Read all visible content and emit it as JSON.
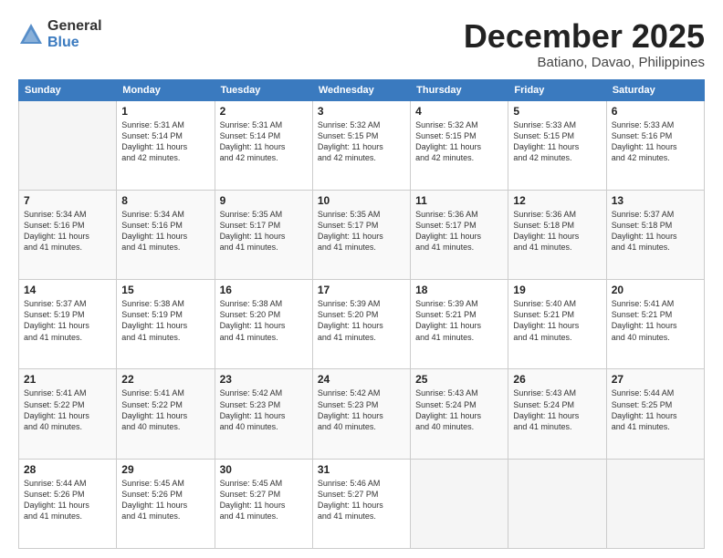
{
  "logo": {
    "general": "General",
    "blue": "Blue"
  },
  "title": "December 2025",
  "subtitle": "Batiano, Davao, Philippines",
  "headers": [
    "Sunday",
    "Monday",
    "Tuesday",
    "Wednesday",
    "Thursday",
    "Friday",
    "Saturday"
  ],
  "weeks": [
    [
      {
        "day": "",
        "info": ""
      },
      {
        "day": "1",
        "info": "Sunrise: 5:31 AM\nSunset: 5:14 PM\nDaylight: 11 hours\nand 42 minutes."
      },
      {
        "day": "2",
        "info": "Sunrise: 5:31 AM\nSunset: 5:14 PM\nDaylight: 11 hours\nand 42 minutes."
      },
      {
        "day": "3",
        "info": "Sunrise: 5:32 AM\nSunset: 5:15 PM\nDaylight: 11 hours\nand 42 minutes."
      },
      {
        "day": "4",
        "info": "Sunrise: 5:32 AM\nSunset: 5:15 PM\nDaylight: 11 hours\nand 42 minutes."
      },
      {
        "day": "5",
        "info": "Sunrise: 5:33 AM\nSunset: 5:15 PM\nDaylight: 11 hours\nand 42 minutes."
      },
      {
        "day": "6",
        "info": "Sunrise: 5:33 AM\nSunset: 5:16 PM\nDaylight: 11 hours\nand 42 minutes."
      }
    ],
    [
      {
        "day": "7",
        "info": "Sunrise: 5:34 AM\nSunset: 5:16 PM\nDaylight: 11 hours\nand 41 minutes."
      },
      {
        "day": "8",
        "info": "Sunrise: 5:34 AM\nSunset: 5:16 PM\nDaylight: 11 hours\nand 41 minutes."
      },
      {
        "day": "9",
        "info": "Sunrise: 5:35 AM\nSunset: 5:17 PM\nDaylight: 11 hours\nand 41 minutes."
      },
      {
        "day": "10",
        "info": "Sunrise: 5:35 AM\nSunset: 5:17 PM\nDaylight: 11 hours\nand 41 minutes."
      },
      {
        "day": "11",
        "info": "Sunrise: 5:36 AM\nSunset: 5:17 PM\nDaylight: 11 hours\nand 41 minutes."
      },
      {
        "day": "12",
        "info": "Sunrise: 5:36 AM\nSunset: 5:18 PM\nDaylight: 11 hours\nand 41 minutes."
      },
      {
        "day": "13",
        "info": "Sunrise: 5:37 AM\nSunset: 5:18 PM\nDaylight: 11 hours\nand 41 minutes."
      }
    ],
    [
      {
        "day": "14",
        "info": "Sunrise: 5:37 AM\nSunset: 5:19 PM\nDaylight: 11 hours\nand 41 minutes."
      },
      {
        "day": "15",
        "info": "Sunrise: 5:38 AM\nSunset: 5:19 PM\nDaylight: 11 hours\nand 41 minutes."
      },
      {
        "day": "16",
        "info": "Sunrise: 5:38 AM\nSunset: 5:20 PM\nDaylight: 11 hours\nand 41 minutes."
      },
      {
        "day": "17",
        "info": "Sunrise: 5:39 AM\nSunset: 5:20 PM\nDaylight: 11 hours\nand 41 minutes."
      },
      {
        "day": "18",
        "info": "Sunrise: 5:39 AM\nSunset: 5:21 PM\nDaylight: 11 hours\nand 41 minutes."
      },
      {
        "day": "19",
        "info": "Sunrise: 5:40 AM\nSunset: 5:21 PM\nDaylight: 11 hours\nand 41 minutes."
      },
      {
        "day": "20",
        "info": "Sunrise: 5:41 AM\nSunset: 5:21 PM\nDaylight: 11 hours\nand 40 minutes."
      }
    ],
    [
      {
        "day": "21",
        "info": "Sunrise: 5:41 AM\nSunset: 5:22 PM\nDaylight: 11 hours\nand 40 minutes."
      },
      {
        "day": "22",
        "info": "Sunrise: 5:41 AM\nSunset: 5:22 PM\nDaylight: 11 hours\nand 40 minutes."
      },
      {
        "day": "23",
        "info": "Sunrise: 5:42 AM\nSunset: 5:23 PM\nDaylight: 11 hours\nand 40 minutes."
      },
      {
        "day": "24",
        "info": "Sunrise: 5:42 AM\nSunset: 5:23 PM\nDaylight: 11 hours\nand 40 minutes."
      },
      {
        "day": "25",
        "info": "Sunrise: 5:43 AM\nSunset: 5:24 PM\nDaylight: 11 hours\nand 40 minutes."
      },
      {
        "day": "26",
        "info": "Sunrise: 5:43 AM\nSunset: 5:24 PM\nDaylight: 11 hours\nand 41 minutes."
      },
      {
        "day": "27",
        "info": "Sunrise: 5:44 AM\nSunset: 5:25 PM\nDaylight: 11 hours\nand 41 minutes."
      }
    ],
    [
      {
        "day": "28",
        "info": "Sunrise: 5:44 AM\nSunset: 5:26 PM\nDaylight: 11 hours\nand 41 minutes."
      },
      {
        "day": "29",
        "info": "Sunrise: 5:45 AM\nSunset: 5:26 PM\nDaylight: 11 hours\nand 41 minutes."
      },
      {
        "day": "30",
        "info": "Sunrise: 5:45 AM\nSunset: 5:27 PM\nDaylight: 11 hours\nand 41 minutes."
      },
      {
        "day": "31",
        "info": "Sunrise: 5:46 AM\nSunset: 5:27 PM\nDaylight: 11 hours\nand 41 minutes."
      },
      {
        "day": "",
        "info": ""
      },
      {
        "day": "",
        "info": ""
      },
      {
        "day": "",
        "info": ""
      }
    ]
  ]
}
